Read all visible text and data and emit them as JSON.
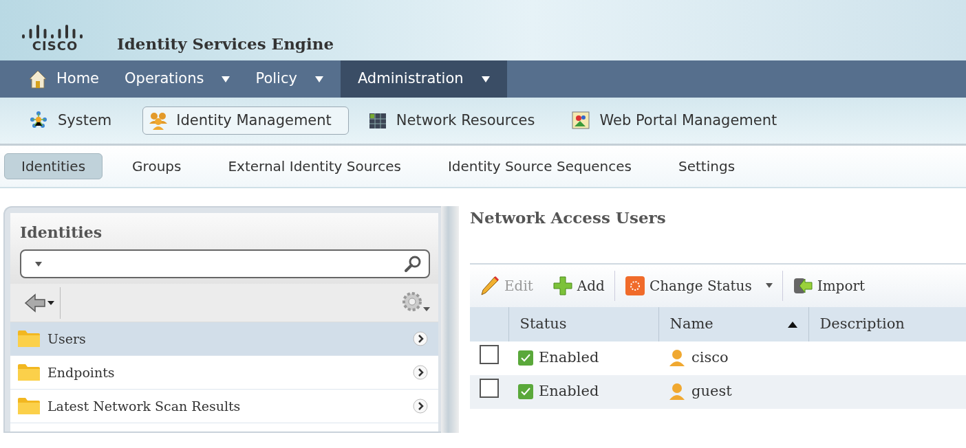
{
  "header": {
    "logo_text": "CISCO",
    "title": "Identity Services Engine"
  },
  "main_nav": [
    {
      "label": "Home",
      "kind": "home",
      "selected": false
    },
    {
      "label": "Operations",
      "kind": "menu",
      "selected": false
    },
    {
      "label": "Policy",
      "kind": "menu",
      "selected": false
    },
    {
      "label": "Administration",
      "kind": "menu",
      "selected": true
    }
  ],
  "sub_nav": [
    {
      "label": "System",
      "kind": "system",
      "selected": false
    },
    {
      "label": "Identity Management",
      "kind": "identity",
      "selected": true
    },
    {
      "label": "Network Resources",
      "kind": "network",
      "selected": false
    },
    {
      "label": "Web Portal Management",
      "kind": "portal",
      "selected": false
    }
  ],
  "tabs": [
    {
      "label": "Identities",
      "selected": true
    },
    {
      "label": "Groups",
      "selected": false
    },
    {
      "label": "External Identity Sources",
      "selected": false
    },
    {
      "label": "Identity Source Sequences",
      "selected": false
    },
    {
      "label": "Settings",
      "selected": false
    }
  ],
  "sidebar": {
    "title": "Identities",
    "items": [
      {
        "label": "Users",
        "selected": true
      },
      {
        "label": "Endpoints",
        "selected": false
      },
      {
        "label": "Latest Network Scan Results",
        "selected": false
      }
    ]
  },
  "content": {
    "title": "Network Access Users",
    "toolbar": [
      {
        "label": "Edit",
        "kind": "edit",
        "disabled": true,
        "has_menu": false
      },
      {
        "label": "Add",
        "kind": "add",
        "disabled": false,
        "has_menu": false
      },
      {
        "label": "Change Status",
        "kind": "status",
        "disabled": false,
        "has_menu": true
      },
      {
        "label": "Import",
        "kind": "import",
        "disabled": false,
        "has_menu": false
      }
    ],
    "table": {
      "columns": [
        {
          "label": "Status",
          "sorted": false
        },
        {
          "label": "Name",
          "sorted": true
        },
        {
          "label": "Description",
          "sorted": false
        }
      ],
      "rows": [
        {
          "checked": false,
          "status": "Enabled",
          "enabled": true,
          "name": "cisco"
        },
        {
          "checked": false,
          "status": "Enabled",
          "enabled": true,
          "name": "guest"
        }
      ]
    }
  }
}
